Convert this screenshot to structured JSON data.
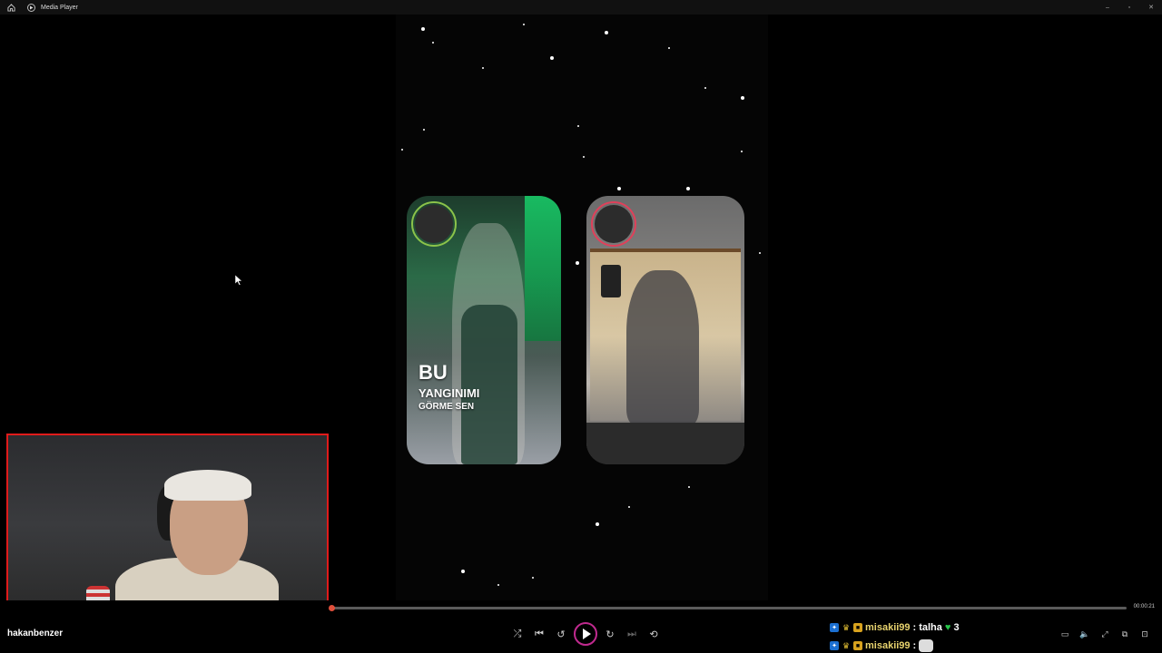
{
  "window": {
    "title": "Media Player",
    "home_icon": "home-icon",
    "app_icon": "play-circle-icon",
    "controls": [
      "minimize-icon",
      "restore-icon",
      "close-icon"
    ],
    "minimize_glyph": "–",
    "restore_glyph": "▫",
    "close_glyph": "✕"
  },
  "video": {
    "overlay_line_1": "BU",
    "overlay_line_2": "YANGINIMI",
    "overlay_line_3": "GÖRME SEN",
    "left_avatar_ring_color": "#8bc34a",
    "right_avatar_ring_color": "#e0405a"
  },
  "player": {
    "progress_fraction": 0.0,
    "time": "00:00:21",
    "channel_name": "hakanbenzer",
    "accent_color": "#e04f3b",
    "play_ring_color": "#c02a8f",
    "buttons": {
      "shuffle": "⤮",
      "previous": "⏮",
      "rewind": "↺",
      "forward": "↻",
      "next": "⏭",
      "repeat": "⟲"
    }
  },
  "chat": [
    {
      "user": "misakii99",
      "separator": ":",
      "message": "talha",
      "heart": "♥",
      "suffix": "3"
    },
    {
      "user": "misakii99",
      "separator": ":",
      "message": ""
    }
  ],
  "right_controls": {
    "miniplayer": "▭",
    "volume": "🔈",
    "fullscreen": "⤢",
    "settings": "⧉",
    "more": "⊡"
  }
}
